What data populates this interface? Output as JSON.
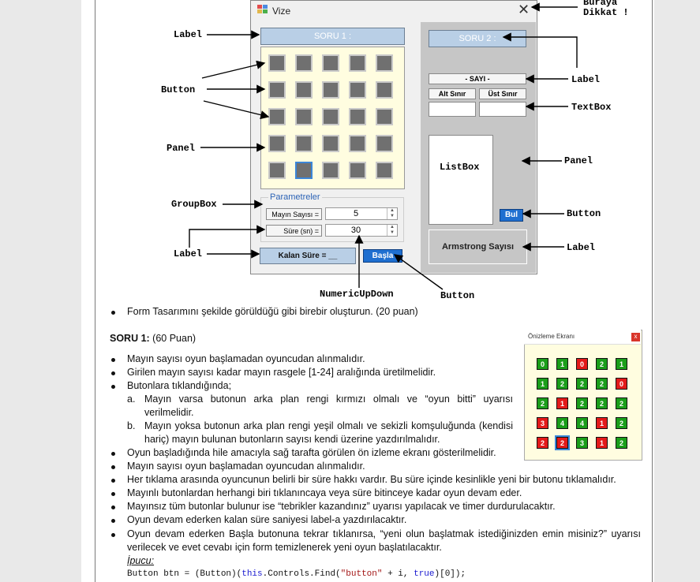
{
  "form": {
    "title": "Vize",
    "close": "✕",
    "soru1_label": "SORU 1 :",
    "soru2_label": "SORU 2 :",
    "group_title": "Parametreler",
    "mine_label": "Mayın Sayısı =",
    "mine_value": "5",
    "time_label": "Süre (sn) =",
    "time_value": "30",
    "remaining_label": "Kalan Süre = __",
    "start_button": "Başla",
    "sayi_label": "- SAYI -",
    "alt_label": "Alt Sınır",
    "ust_label": "Üst Sınır",
    "listbox_label": "ListBox",
    "find_button": "Bul",
    "armstrong_label": "Armstrong Sayısı"
  },
  "annotations": {
    "buraya": "Buraya",
    "dikkat": "Dikkat !",
    "label_left_top": "Label",
    "button_left": "Button",
    "panel_left": "Panel",
    "groupbox": "GroupBox",
    "label_left_bottom": "Label",
    "numeric": "NumericUpDown",
    "button_bottom": "Button",
    "label_right_top": "Label",
    "textbox": "TextBox",
    "panel_right": "Panel",
    "button_right": "Button",
    "label_right_bottom": "Label"
  },
  "text": {
    "form_design": "Form Tasarımını şekilde görüldüğü gibi birebir oluşturun. (20 puan)",
    "soru1_title": "SORU 1:",
    "soru1_points": " (60 Puan)",
    "b1": "Mayın sayısı oyun başlamadan oyuncudan alınmalıdır.",
    "b2": "Girilen mayın sayısı kadar mayın rasgele [1-24] aralığında üretilmelidir.",
    "b3": "Butonlara tıklandığında;",
    "a_marker": "a.",
    "a1": "Mayın varsa butonun arka plan rengi kırmızı olmalı ve “oyun bitti” uyarısı",
    "a2": "verilmelidir.",
    "b_marker": "b.",
    "bb1": "Mayın yoksa butonun arka plan rengi yeşil olmalı ve sekizli komşuluğunda (kendisi",
    "bb2": "hariç) mayın bulunan butonların sayısı kendi üzerine yazdırılmalıdır.",
    "b4": "Oyun başladığında hile amacıyla sağ tarafta görülen ön izleme ekranı gösterilmelidir.",
    "b5": "Mayın sayısı oyun başlamadan oyuncudan alınmalıdır.",
    "b6": "Her tıklama arasında oyuncunun belirli bir süre hakkı vardır. Bu süre içinde kesinlikle yeni bir butonu tıklamalıdır.",
    "b7": "Mayınlı butonlardan herhangi biri tıklanıncaya veya süre bitinceye kadar oyun devam eder.",
    "b8": "Mayınsız tüm butonlar bulunur ise “tebrikler kazandınız” uyarısı yapılacak ve timer durdurulacaktır.",
    "b9": "Oyun devam ederken kalan süre saniyesi label-a yazdırılacaktır.",
    "b10a": "Oyun devam ederken Başla butonuna tekrar tıklanırsa, “yeni olun başlatmak istediğinizden emin misiniz?” uyarısı",
    "b10b": "verilecek ve evet cevabı için form temizlenerek yeni oyun başlatılacaktır.",
    "ipucu": "İpucu:",
    "code_a": "Button btn = (Button)(",
    "code_this": "this",
    "code_b": ".Controls.Find(",
    "code_str": "\"button\"",
    "code_c": " + i, ",
    "code_true": "true",
    "code_d": ")[0]);"
  },
  "preview": {
    "title": "Önizleme Ekranı",
    "close": "x",
    "rows": [
      [
        {
          "v": "0",
          "c": "g"
        },
        {
          "v": "1",
          "c": "g"
        },
        {
          "v": "0",
          "c": "r"
        },
        {
          "v": "2",
          "c": "g"
        },
        {
          "v": "1",
          "c": "g"
        }
      ],
      [
        {
          "v": "1",
          "c": "g"
        },
        {
          "v": "2",
          "c": "g"
        },
        {
          "v": "2",
          "c": "g"
        },
        {
          "v": "2",
          "c": "g"
        },
        {
          "v": "0",
          "c": "r"
        }
      ],
      [
        {
          "v": "2",
          "c": "g"
        },
        {
          "v": "1",
          "c": "r"
        },
        {
          "v": "2",
          "c": "g"
        },
        {
          "v": "2",
          "c": "g"
        },
        {
          "v": "2",
          "c": "g"
        }
      ],
      [
        {
          "v": "3",
          "c": "r"
        },
        {
          "v": "4",
          "c": "g"
        },
        {
          "v": "4",
          "c": "g"
        },
        {
          "v": "1",
          "c": "r"
        },
        {
          "v": "2",
          "c": "g"
        }
      ],
      [
        {
          "v": "2",
          "c": "r"
        },
        {
          "v": "2",
          "c": "r"
        },
        {
          "v": "3",
          "c": "g"
        },
        {
          "v": "1",
          "c": "r"
        },
        {
          "v": "2",
          "c": "g"
        }
      ]
    ]
  },
  "colors": {
    "green": "#1a9e1a",
    "red": "#e31a1a"
  }
}
